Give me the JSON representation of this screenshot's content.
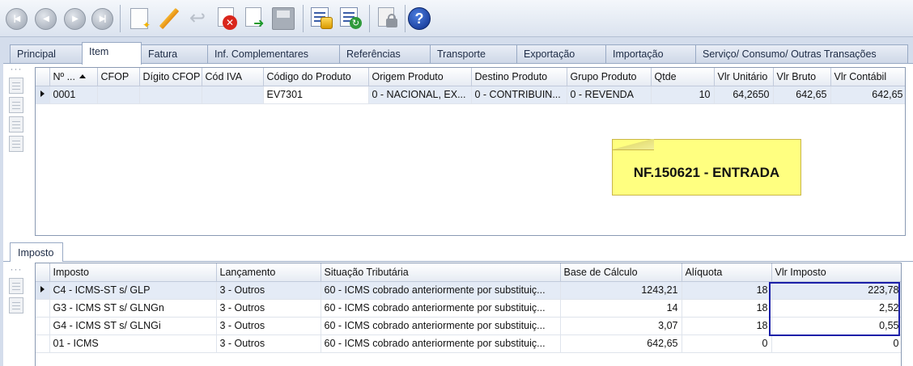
{
  "toolbar": {
    "buttons": [
      {
        "name": "first-record",
        "icon": "first-icon"
      },
      {
        "name": "previous-record",
        "icon": "previous-icon"
      },
      {
        "name": "next-record",
        "icon": "next-icon"
      },
      {
        "name": "last-record",
        "icon": "last-icon"
      },
      {
        "name": "new",
        "icon": "new-document-icon"
      },
      {
        "name": "edit",
        "icon": "pencil-icon"
      },
      {
        "name": "undo",
        "icon": "undo-icon"
      },
      {
        "name": "delete",
        "icon": "delete-icon"
      },
      {
        "name": "confirm",
        "icon": "confirm-icon"
      },
      {
        "name": "save",
        "icon": "save-icon"
      },
      {
        "name": "calculate",
        "icon": "coins-icon"
      },
      {
        "name": "refresh",
        "icon": "refresh-document-icon"
      },
      {
        "name": "lock",
        "icon": "lock-icon"
      },
      {
        "name": "help",
        "icon": "help-icon",
        "glyph": "?"
      }
    ]
  },
  "tabs": [
    {
      "label": "Principal",
      "active": false
    },
    {
      "label": "Item",
      "active": true
    },
    {
      "label": "Fatura",
      "active": false
    },
    {
      "label": "Inf. Complementares",
      "active": false
    },
    {
      "label": "Referências",
      "active": false
    },
    {
      "label": "Transporte",
      "active": false
    },
    {
      "label": "Exportação",
      "active": false
    },
    {
      "label": "Importação",
      "active": false
    },
    {
      "label": "Serviço/ Consumo/ Outras Transações",
      "active": false
    }
  ],
  "items_grid": {
    "columns": [
      "Nº ...",
      "CFOP",
      "Dígito CFOP",
      "Cód IVA",
      "Código do Produto",
      "Origem Produto",
      "Destino Produto",
      "Grupo Produto",
      "Qtde",
      "Vlr Unitário",
      "Vlr Bruto",
      "Vlr Contábil"
    ],
    "rows": [
      [
        "0001",
        "",
        "",
        "",
        "EV7301",
        "0 - NACIONAL, EX...",
        "0 - CONTRIBUIN...",
        "0 - REVENDA",
        "10",
        "64,2650",
        "642,65",
        "642,65"
      ]
    ]
  },
  "note": {
    "text": "NF.150621 - ENTRADA",
    "color": "#ffff80"
  },
  "sub_tab": {
    "label": "Imposto"
  },
  "tax_grid": {
    "columns": [
      "Imposto",
      "Lançamento",
      "Situação Tributária",
      "Base de Cálculo",
      "Alíquota",
      "Vlr Imposto"
    ],
    "rows": [
      [
        "C4 - ICMS-ST s/ GLP",
        "3 - Outros",
        "60 - ICMS cobrado anteriormente por substituiç...",
        "1243,21",
        "18",
        "223,78"
      ],
      [
        "G3 - ICMS ST s/ GLNGn",
        "3 - Outros",
        "60 - ICMS cobrado anteriormente por substituiç...",
        "14",
        "18",
        "2,52"
      ],
      [
        "G4 - ICMS ST s/ GLNGi",
        "3 - Outros",
        "60 - ICMS cobrado anteriormente por substituiç...",
        "3,07",
        "18",
        "0,55"
      ],
      [
        "01 - ICMS",
        "3 - Outros",
        "60 - ICMS cobrado anteriormente por substituiç...",
        "642,65",
        "0",
        "0"
      ]
    ]
  },
  "colors": {
    "highlight_border": "#1b1fa8",
    "selected_row": "#e4ebf6",
    "help_blue": "#0d2d8a"
  }
}
